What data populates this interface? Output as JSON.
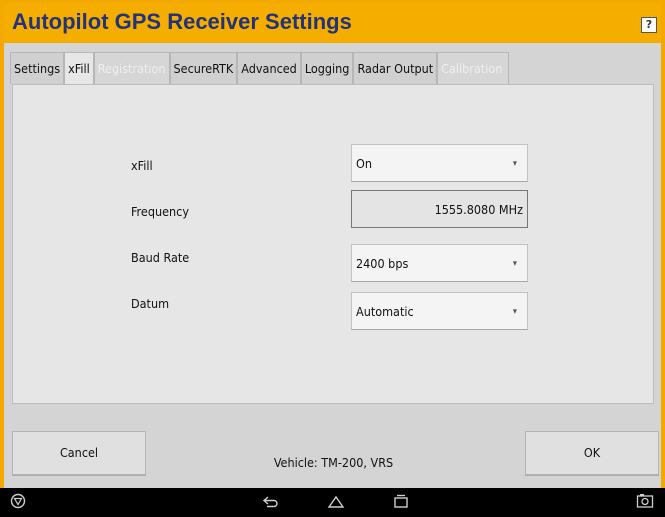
{
  "window": {
    "title": "Autopilot GPS Receiver Settings",
    "help_label": "?"
  },
  "tabs": [
    {
      "label": "Settings",
      "state": "normal"
    },
    {
      "label": "xFill",
      "state": "active"
    },
    {
      "label": "Registration",
      "state": "disabled"
    },
    {
      "label": "SecureRTK",
      "state": "normal"
    },
    {
      "label": "Advanced",
      "state": "normal"
    },
    {
      "label": "Logging",
      "state": "normal"
    },
    {
      "label": "Radar Output",
      "state": "normal"
    },
    {
      "label": "Calibration",
      "state": "disabled"
    }
  ],
  "form": {
    "xfill": {
      "label": "xFill",
      "value": "On"
    },
    "frequency": {
      "label": "Frequency",
      "value": "1555.8080 MHz"
    },
    "baud_rate": {
      "label": "Baud Rate",
      "value": "2400 bps"
    },
    "datum": {
      "label": "Datum",
      "value": "Automatic"
    }
  },
  "footer": {
    "cancel_label": "Cancel",
    "vehicle_text": "Vehicle: TM-200, VRS",
    "ok_label": "OK"
  },
  "navbar": {
    "icons": [
      "brand-icon",
      "back-icon",
      "home-icon",
      "recent-apps-icon",
      "screenshot-icon"
    ]
  }
}
